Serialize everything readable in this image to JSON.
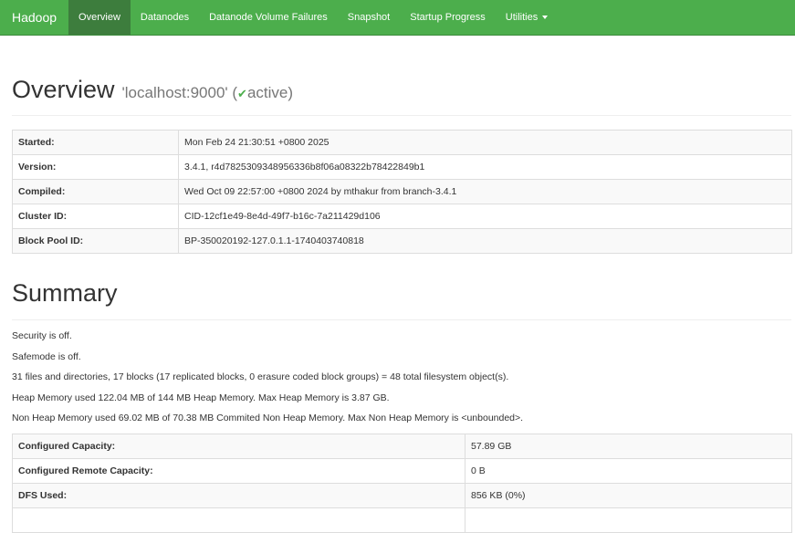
{
  "navbar": {
    "brand": "Hadoop",
    "items": [
      {
        "label": "Overview",
        "active": true
      },
      {
        "label": "Datanodes"
      },
      {
        "label": "Datanode Volume Failures"
      },
      {
        "label": "Snapshot"
      },
      {
        "label": "Startup Progress"
      },
      {
        "label": "Utilities"
      }
    ]
  },
  "overview": {
    "title": "Overview",
    "host": "'localhost:9000' (",
    "status": "active",
    "status_close": ")",
    "rows": [
      {
        "key": "Started:",
        "value": "Mon Feb 24 21:30:51 +0800 2025"
      },
      {
        "key": "Version:",
        "value": "3.4.1, r4d7825309348956336b8f06a08322b78422849b1"
      },
      {
        "key": "Compiled:",
        "value": "Wed Oct 09 22:57:00 +0800 2024 by mthakur from branch-3.4.1"
      },
      {
        "key": "Cluster ID:",
        "value": "CID-12cf1e49-8e4d-49f7-b16c-7a211429d106"
      },
      {
        "key": "Block Pool ID:",
        "value": "BP-350020192-127.0.1.1-1740403740818"
      }
    ]
  },
  "summary": {
    "title": "Summary",
    "lines": [
      "Security is off.",
      "Safemode is off.",
      "31 files and directories, 17 blocks (17 replicated blocks, 0 erasure coded block groups) = 48 total filesystem object(s).",
      "Heap Memory used 122.04 MB of 144 MB Heap Memory. Max Heap Memory is 3.87 GB.",
      "Non Heap Memory used 69.02 MB of 70.38 MB Commited Non Heap Memory. Max Non Heap Memory is <unbounded>."
    ],
    "capacity": [
      {
        "key": "Configured Capacity:",
        "value": "57.89 GB"
      },
      {
        "key": "Configured Remote Capacity:",
        "value": "0 B"
      },
      {
        "key": "DFS Used:",
        "value": "856 KB (0%)"
      },
      {
        "key": "",
        "value": ""
      }
    ]
  },
  "colors": {
    "navbar": "#4cae4c",
    "active_tab": "#3d7d3d",
    "check": "#4cae4c"
  }
}
